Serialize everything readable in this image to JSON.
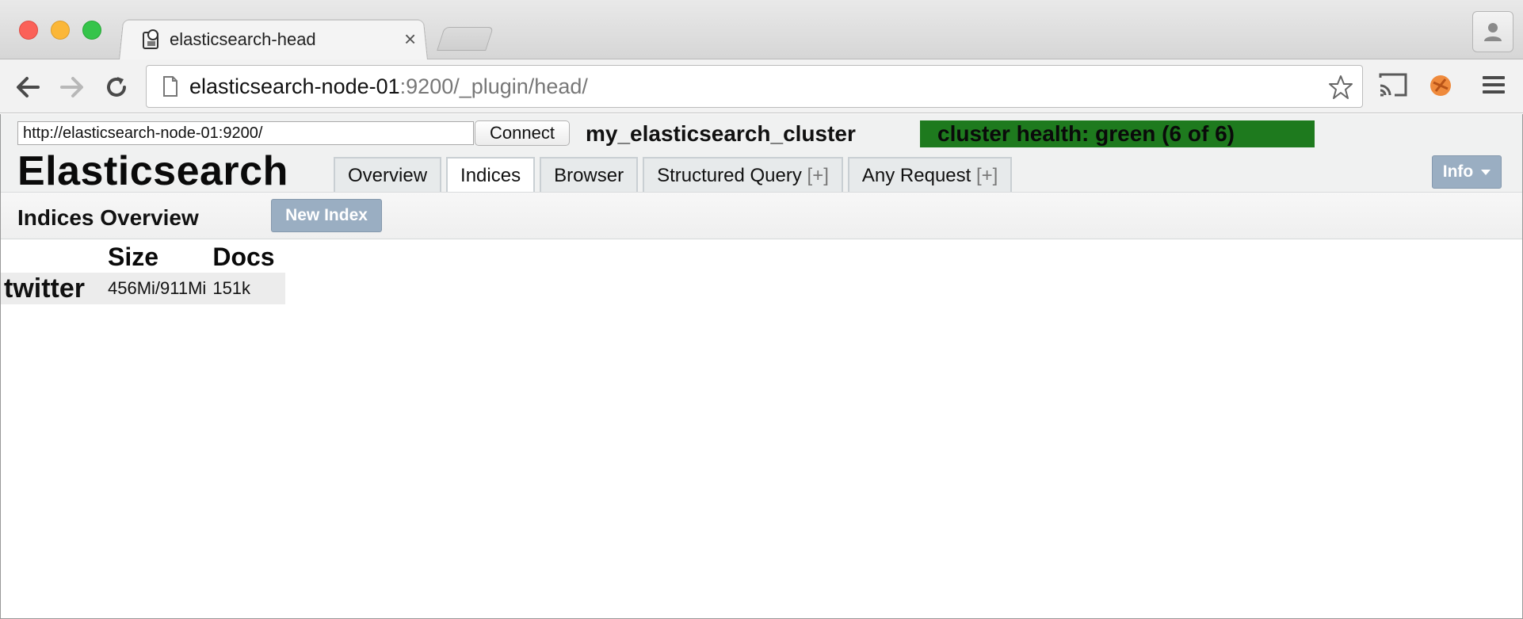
{
  "browser": {
    "tab_title": "elasticsearch-head",
    "url_host": "elasticsearch-node-01",
    "url_rest": ":9200/_plugin/head/"
  },
  "head": {
    "connect_url": "http://elasticsearch-node-01:9200/",
    "connect_label": "Connect",
    "cluster_name": "my_elasticsearch_cluster",
    "cluster_health": "cluster health: green (6 of 6)",
    "brand": "Elasticsearch",
    "tabs": [
      {
        "label": "Overview",
        "suffix": ""
      },
      {
        "label": "Indices",
        "suffix": ""
      },
      {
        "label": "Browser",
        "suffix": ""
      },
      {
        "label": "Structured Query ",
        "suffix": "[+]"
      },
      {
        "label": "Any Request ",
        "suffix": "[+]"
      }
    ],
    "active_tab": "Indices",
    "info_label": "Info"
  },
  "indices": {
    "title": "Indices Overview",
    "new_index_label": "New Index",
    "columns": [
      "Size",
      "Docs"
    ],
    "rows": [
      {
        "name": "twitter",
        "size": "456Mi/911Mi",
        "docs": "151k"
      }
    ]
  },
  "colors": {
    "health_green": "#1e7a1e",
    "button_blue_gray": "#9aaec2"
  }
}
